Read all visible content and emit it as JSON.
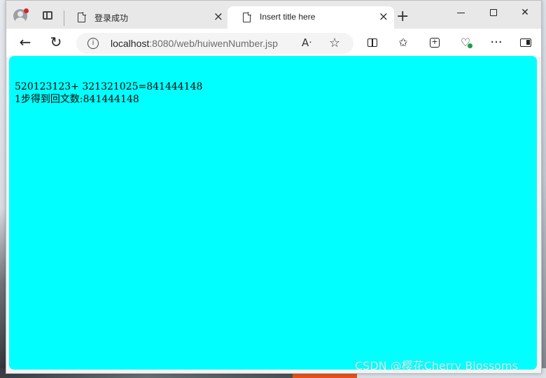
{
  "browser": {
    "tabs": [
      {
        "title": "登录成功",
        "active": false,
        "close_icon": "close-icon"
      },
      {
        "title": "Insert title here",
        "active": true,
        "close_icon": "close-icon"
      }
    ],
    "new_tab_symbol": "+",
    "window_controls": {
      "minimize": "minimize-icon",
      "maximize": "maximize-icon",
      "close": "close-icon"
    },
    "toolbar": {
      "back_icon": "back-arrow-icon",
      "reload_icon": "reload-icon",
      "url_host": "localhost",
      "url_rest": ":8080/web/huiwenNumber.jsp",
      "read_aloud_label": "A͡",
      "favorite_icon": "star-icon",
      "icons": [
        "split-screen-icon",
        "favorites-icon",
        "collections-icon",
        "browser-essentials-icon",
        "more-icon",
        "sidebar-icon"
      ]
    }
  },
  "page": {
    "background_color": "#00ffff",
    "lines": [
      "520123123+ 321321025=841444148",
      "1步得到回文数:841444148"
    ]
  },
  "watermark": "CSDN @樱花Cherry Blossoms",
  "colors": {
    "profile_notification": "#d91f2a",
    "health_indicator": "#1a9e4b"
  }
}
